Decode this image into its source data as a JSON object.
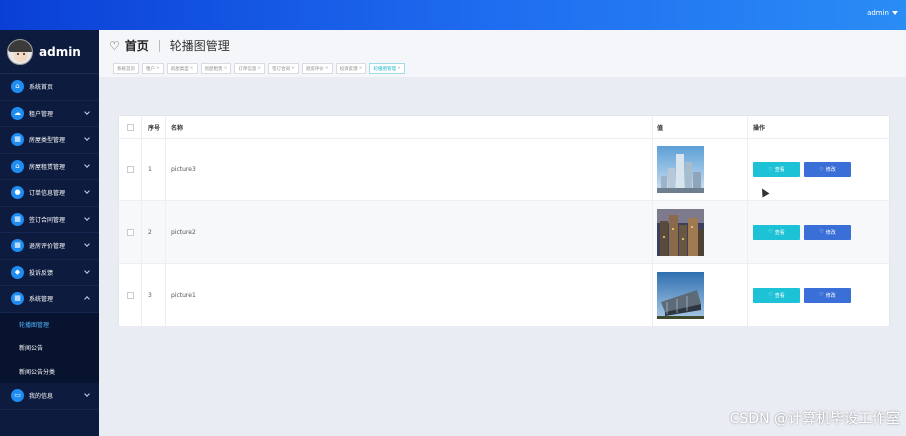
{
  "topbar": {
    "user_label": "admin"
  },
  "sidebar": {
    "brand": "admin",
    "items": [
      {
        "label": "系统首页",
        "icon": "home-icon"
      },
      {
        "label": "租户管理",
        "icon": "cloud-icon"
      },
      {
        "label": "房屋类型管理",
        "icon": "grid-icon"
      },
      {
        "label": "房屋租赁管理",
        "icon": "house-icon"
      },
      {
        "label": "订单信息管理",
        "icon": "user-icon"
      },
      {
        "label": "签订合同管理",
        "icon": "grid-icon"
      },
      {
        "label": "退房评价管理",
        "icon": "grid-icon"
      },
      {
        "label": "投诉反馈",
        "icon": "shield-icon"
      },
      {
        "label": "系统管理",
        "icon": "grid-icon"
      },
      {
        "label": "我的信息",
        "icon": "card-icon"
      }
    ],
    "system_sub": [
      "轮播图管理",
      "新闻公告",
      "新闻公告分类"
    ]
  },
  "header": {
    "home": "首页",
    "title": "轮播图管理",
    "tags": [
      "系统首页",
      "租户",
      "房屋类型",
      "房屋租赁",
      "订单信息",
      "签订合同",
      "退房评价",
      "投诉反馈",
      "轮播图管理"
    ],
    "tag_close": "×"
  },
  "table": {
    "headers": [
      "序号",
      "名称",
      "值",
      "操作"
    ],
    "rows": [
      {
        "idx": "1",
        "name": "picture3"
      },
      {
        "idx": "2",
        "name": "picture2"
      },
      {
        "idx": "3",
        "name": "picture1"
      }
    ],
    "view_label": "查看",
    "edit_label": "修改"
  },
  "watermark": "CSDN @计算机毕设工作室",
  "colors": {
    "topbar": "#1f6df0",
    "sidebar": "#0d1b3e",
    "view_btn": "#1ec2d6",
    "edit_btn": "#3a6fd8",
    "active_sub": "#4fb3ff"
  }
}
